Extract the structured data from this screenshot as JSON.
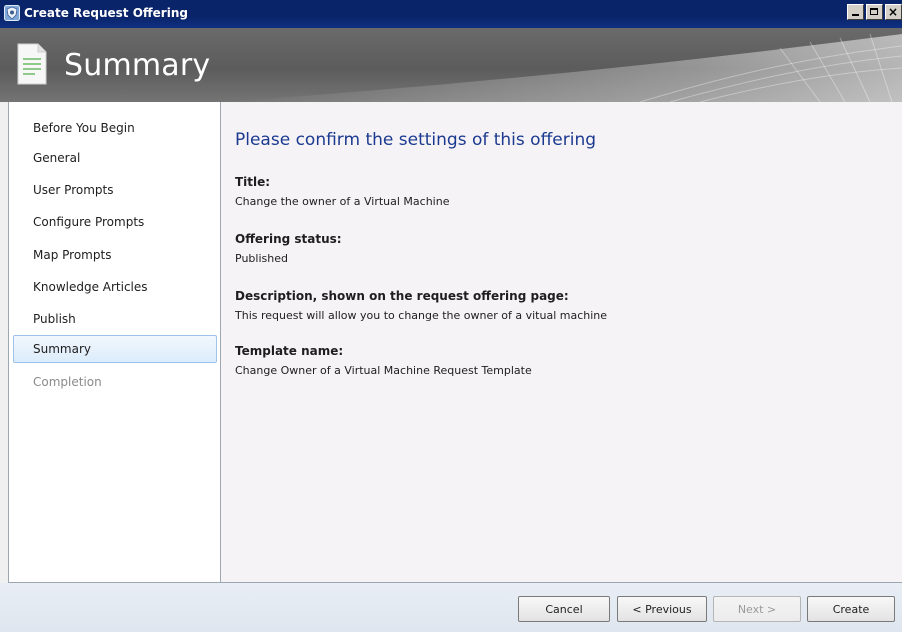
{
  "window": {
    "title": "Create Request Offering",
    "icon": "wizard-shield-icon",
    "controls": {
      "minimize": "minimize-icon",
      "maximize": "maximize-icon",
      "close": "×"
    }
  },
  "banner": {
    "title": "Summary",
    "icon": "document-icon"
  },
  "nav": {
    "items": [
      {
        "label": "Before You Begin",
        "state": "normal"
      },
      {
        "label": "General",
        "state": "normal"
      },
      {
        "label": "User Prompts",
        "state": "normal"
      },
      {
        "label": "Configure Prompts",
        "state": "normal"
      },
      {
        "label": "Map Prompts",
        "state": "normal"
      },
      {
        "label": "Knowledge Articles",
        "state": "normal"
      },
      {
        "label": "Publish",
        "state": "normal"
      },
      {
        "label": "Summary",
        "state": "selected"
      },
      {
        "label": "Completion",
        "state": "disabled"
      }
    ]
  },
  "content": {
    "heading": "Please confirm the settings of this offering",
    "fields": [
      {
        "label": "Title:",
        "value": "Change the owner of a Virtual Machine"
      },
      {
        "label": "Offering status:",
        "value": "Published"
      },
      {
        "label": "Description, shown on the request offering page:",
        "value": "This request will allow you to change the owner of a vitual machine"
      },
      {
        "label": "Template name:",
        "value": "Change Owner of a Virtual Machine Request Template"
      }
    ]
  },
  "footer": {
    "cancel": "Cancel",
    "previous": "< Previous",
    "next": "Next >",
    "create": "Create"
  },
  "colors": {
    "titlebar": "#0a246a",
    "heading": "#1b3a8f",
    "selected_bg": "#dcecfb",
    "selected_border": "#9fc3e8"
  }
}
